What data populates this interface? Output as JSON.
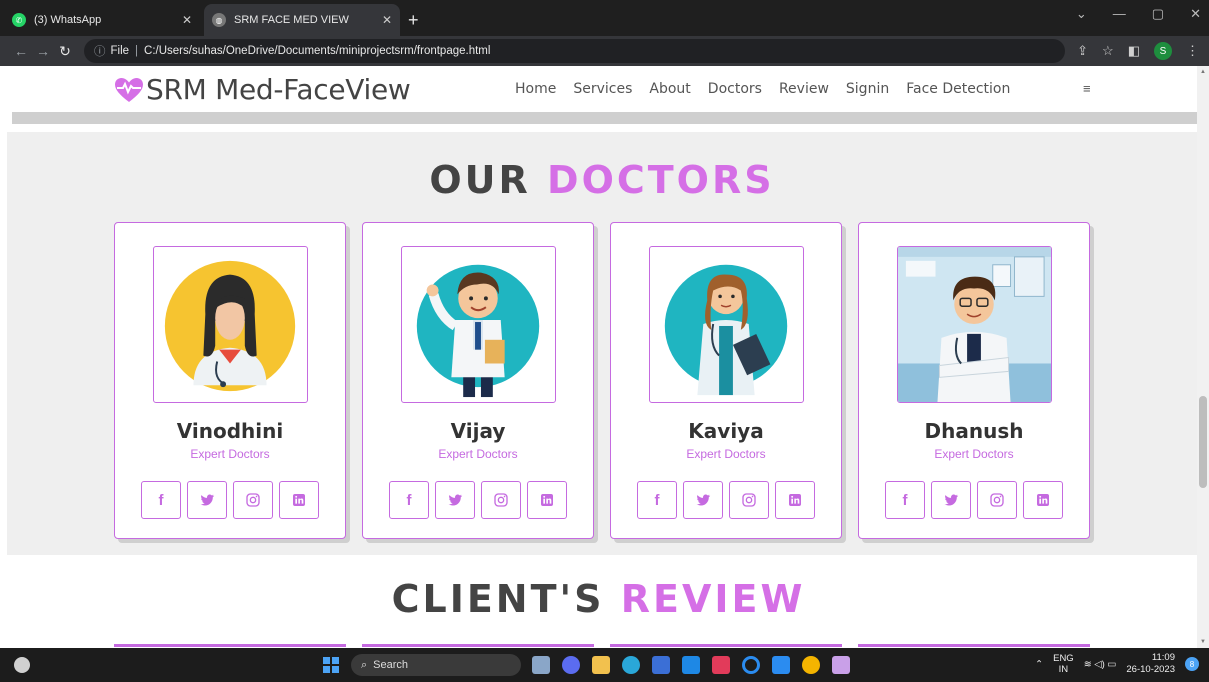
{
  "browser": {
    "tabs": [
      {
        "title": "(3) WhatsApp",
        "icon": "whatsapp-icon",
        "active": false
      },
      {
        "title": "SRM FACE MED VIEW",
        "icon": "globe-icon",
        "active": true
      }
    ],
    "address": {
      "scheme_label": "File",
      "url": "C:/Users/suhas/OneDrive/Documents/miniprojectsrm/frontpage.html"
    },
    "profile_initial": "S"
  },
  "site": {
    "logo_text": "SRM Med-FaceView",
    "nav": [
      "Home",
      "Services",
      "About",
      "Doctors",
      "Review",
      "Signin",
      "Face Detection"
    ],
    "menu_icon": "≡"
  },
  "doctors_section": {
    "title_plain": "OUR",
    "title_highlight": "DOCTORS",
    "doctors": [
      {
        "name": "Vinodhini",
        "role": "Expert Doctors",
        "avatar": "female-doctor-yellow-bg"
      },
      {
        "name": "Vijay",
        "role": "Expert Doctors",
        "avatar": "male-doctor-teal-bg"
      },
      {
        "name": "Kaviya",
        "role": "Expert Doctors",
        "avatar": "female-doctor-teal-bg"
      },
      {
        "name": "Dhanush",
        "role": "Expert Doctors",
        "avatar": "male-doctor-clinic-bg"
      }
    ],
    "socials": [
      "facebook-icon",
      "twitter-icon",
      "instagram-icon",
      "linkedin-icon"
    ]
  },
  "review_section": {
    "title_plain": "CLIENT'S",
    "title_highlight": "REVIEW"
  },
  "taskbar": {
    "search_placeholder": "Search",
    "lang_top": "ENG",
    "lang_bottom": "IN",
    "time": "11:09",
    "date": "26-10-2023",
    "notification_count": "8"
  },
  "colors": {
    "accent": "#d56fe6",
    "heading": "#444444",
    "section_bg": "#efefef"
  }
}
